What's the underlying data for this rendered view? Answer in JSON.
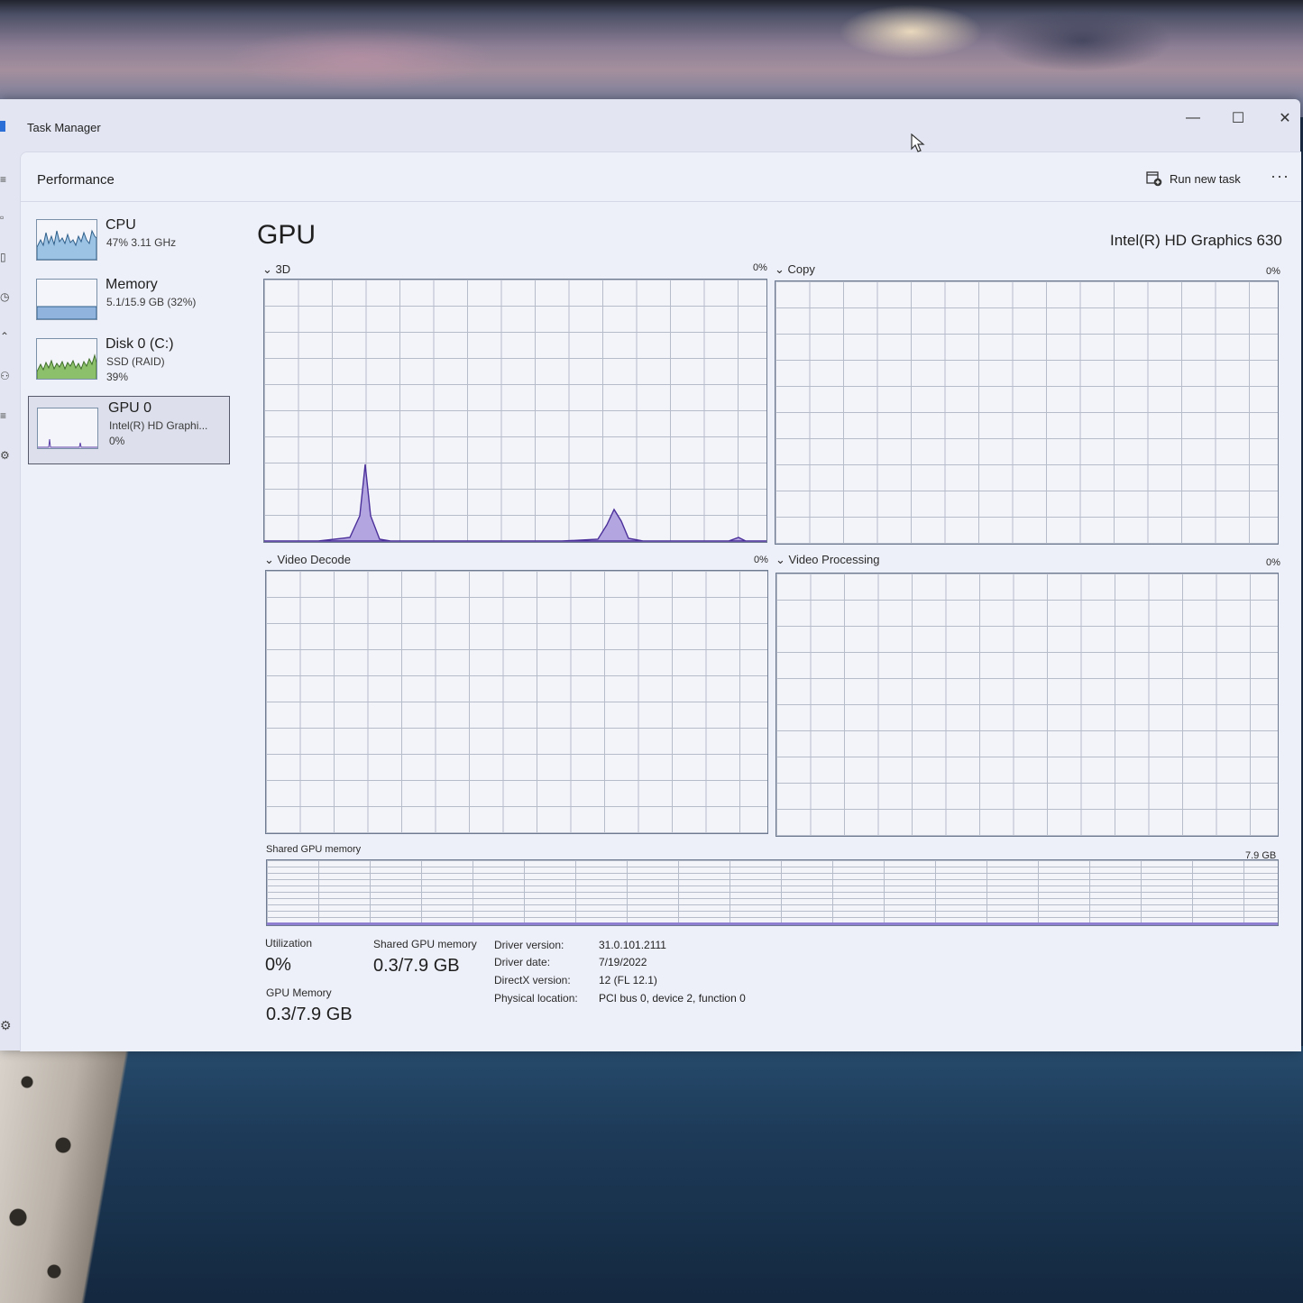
{
  "window": {
    "title": "Task Manager",
    "minimize_icon": "—",
    "maximize_icon": "☐",
    "close_icon": "✕"
  },
  "header": {
    "page_title": "Performance",
    "run_new_task": "Run new task",
    "more_icon": "···"
  },
  "sidebar": {
    "devices": [
      {
        "name": "CPU",
        "line1": "47%  3.11 GHz",
        "line2": ""
      },
      {
        "name": "Memory",
        "line1": "5.1/15.9 GB (32%)",
        "line2": ""
      },
      {
        "name": "Disk 0 (C:)",
        "line1": "SSD (RAID)",
        "line2": "39%"
      },
      {
        "name": "GPU 0",
        "line1": "Intel(R) HD Graphi...",
        "line2": "0%"
      }
    ]
  },
  "gpu": {
    "title": "GPU",
    "model": "Intel(R) HD Graphics 630",
    "engines": [
      {
        "label": "3D",
        "pct": "0%"
      },
      {
        "label": "Copy",
        "pct": "0%"
      },
      {
        "label": "Video Decode",
        "pct": "0%"
      },
      {
        "label": "Video Processing",
        "pct": "0%"
      }
    ],
    "shared_memory": {
      "label": "Shared GPU memory",
      "max": "7.9 GB"
    }
  },
  "stats": {
    "utilization_label": "Utilization",
    "utilization_value": "0%",
    "shared_label": "Shared GPU memory",
    "shared_value": "0.3/7.9 GB",
    "gpu_memory_label": "GPU Memory",
    "gpu_memory_value": "0.3/7.9 GB"
  },
  "properties": [
    {
      "label": "Driver version:",
      "value": "31.0.101.2111"
    },
    {
      "label": "Driver date:",
      "value": "7/19/2022"
    },
    {
      "label": "DirectX version:",
      "value": "12 (FL 12.1)"
    },
    {
      "label": "Physical location:",
      "value": "PCI bus 0, device 2, function 0"
    }
  ],
  "colors": {
    "cpu": "#4f8fc7",
    "memory": "#4f8fc7",
    "disk": "#6aa84f",
    "gpu": "#7b5fc6"
  }
}
